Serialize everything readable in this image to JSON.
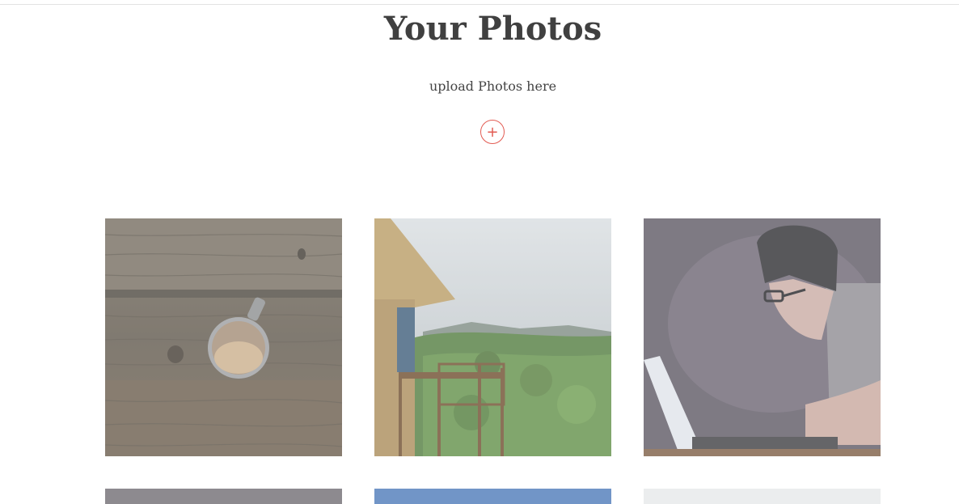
{
  "page": {
    "title": "Your Photos",
    "subtitle": "upload Photos here",
    "add_icon": "plus-icon",
    "add_symbol": "+",
    "accent_color": "#e25b52"
  },
  "gallery": {
    "photos": [
      {
        "subject": "coffee cup on wooden table"
      },
      {
        "subject": "bamboo hut balcony overlooking forested hills"
      },
      {
        "subject": "illustrated person in glasses typing on laptop"
      },
      {
        "subject": "partially visible photo"
      },
      {
        "subject": "partially visible photo"
      },
      {
        "subject": "partially visible photo"
      }
    ]
  }
}
